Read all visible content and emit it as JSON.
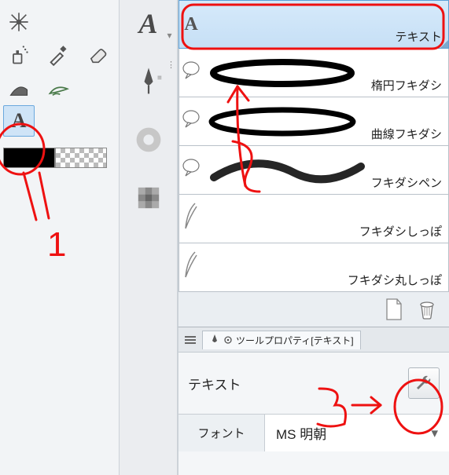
{
  "toolbox_tools": [
    {
      "name": "magic-wand-icon"
    },
    {
      "name": "spray-icon"
    },
    {
      "name": "eyedropper-icon"
    },
    {
      "name": "eraser-icon"
    },
    {
      "name": "fill-icon"
    },
    {
      "name": "leaf-stroke-icon"
    },
    {
      "name": "text-tool-icon",
      "selected": true,
      "glyph": "A"
    }
  ],
  "midstrip": [
    {
      "name": "text-category-icon",
      "glyph": "A"
    },
    {
      "name": "pen-settings-icon"
    },
    {
      "name": "ring-icon"
    },
    {
      "name": "grid-icon"
    }
  ],
  "subtools": [
    {
      "name": "subtool-text",
      "icon": "A",
      "label": "テキスト",
      "selected": true,
      "preview": "none"
    },
    {
      "name": "subtool-ellipse-balloon",
      "icon": "balloon",
      "label": "楕円フキダシ",
      "preview": "ellipse"
    },
    {
      "name": "subtool-curve-balloon",
      "icon": "balloon",
      "label": "曲線フキダシ",
      "preview": "curve"
    },
    {
      "name": "subtool-balloon-pen",
      "icon": "balloon",
      "label": "フキダシペン",
      "preview": "brush"
    },
    {
      "name": "subtool-balloon-tail",
      "icon": "tail",
      "label": "フキダシしっぽ",
      "preview": "tail"
    },
    {
      "name": "subtool-balloon-round-tail",
      "icon": "tail",
      "label": "フキダシ丸しっぽ",
      "preview": "tail"
    }
  ],
  "list_footer": {
    "new_icon": "new-page-icon",
    "trash_icon": "trash-icon"
  },
  "tool_property": {
    "panel_title": "ツールプロパティ[テキスト]",
    "heading": "テキスト",
    "font_label": "フォント",
    "font_value": "MS 明朝"
  },
  "annotations": {
    "label1": "1",
    "label2": "2",
    "label3": "3"
  },
  "colors": {
    "selected_bg": "#cfe4f7",
    "selected_border": "#6aa8de",
    "annotation": "#e11"
  }
}
